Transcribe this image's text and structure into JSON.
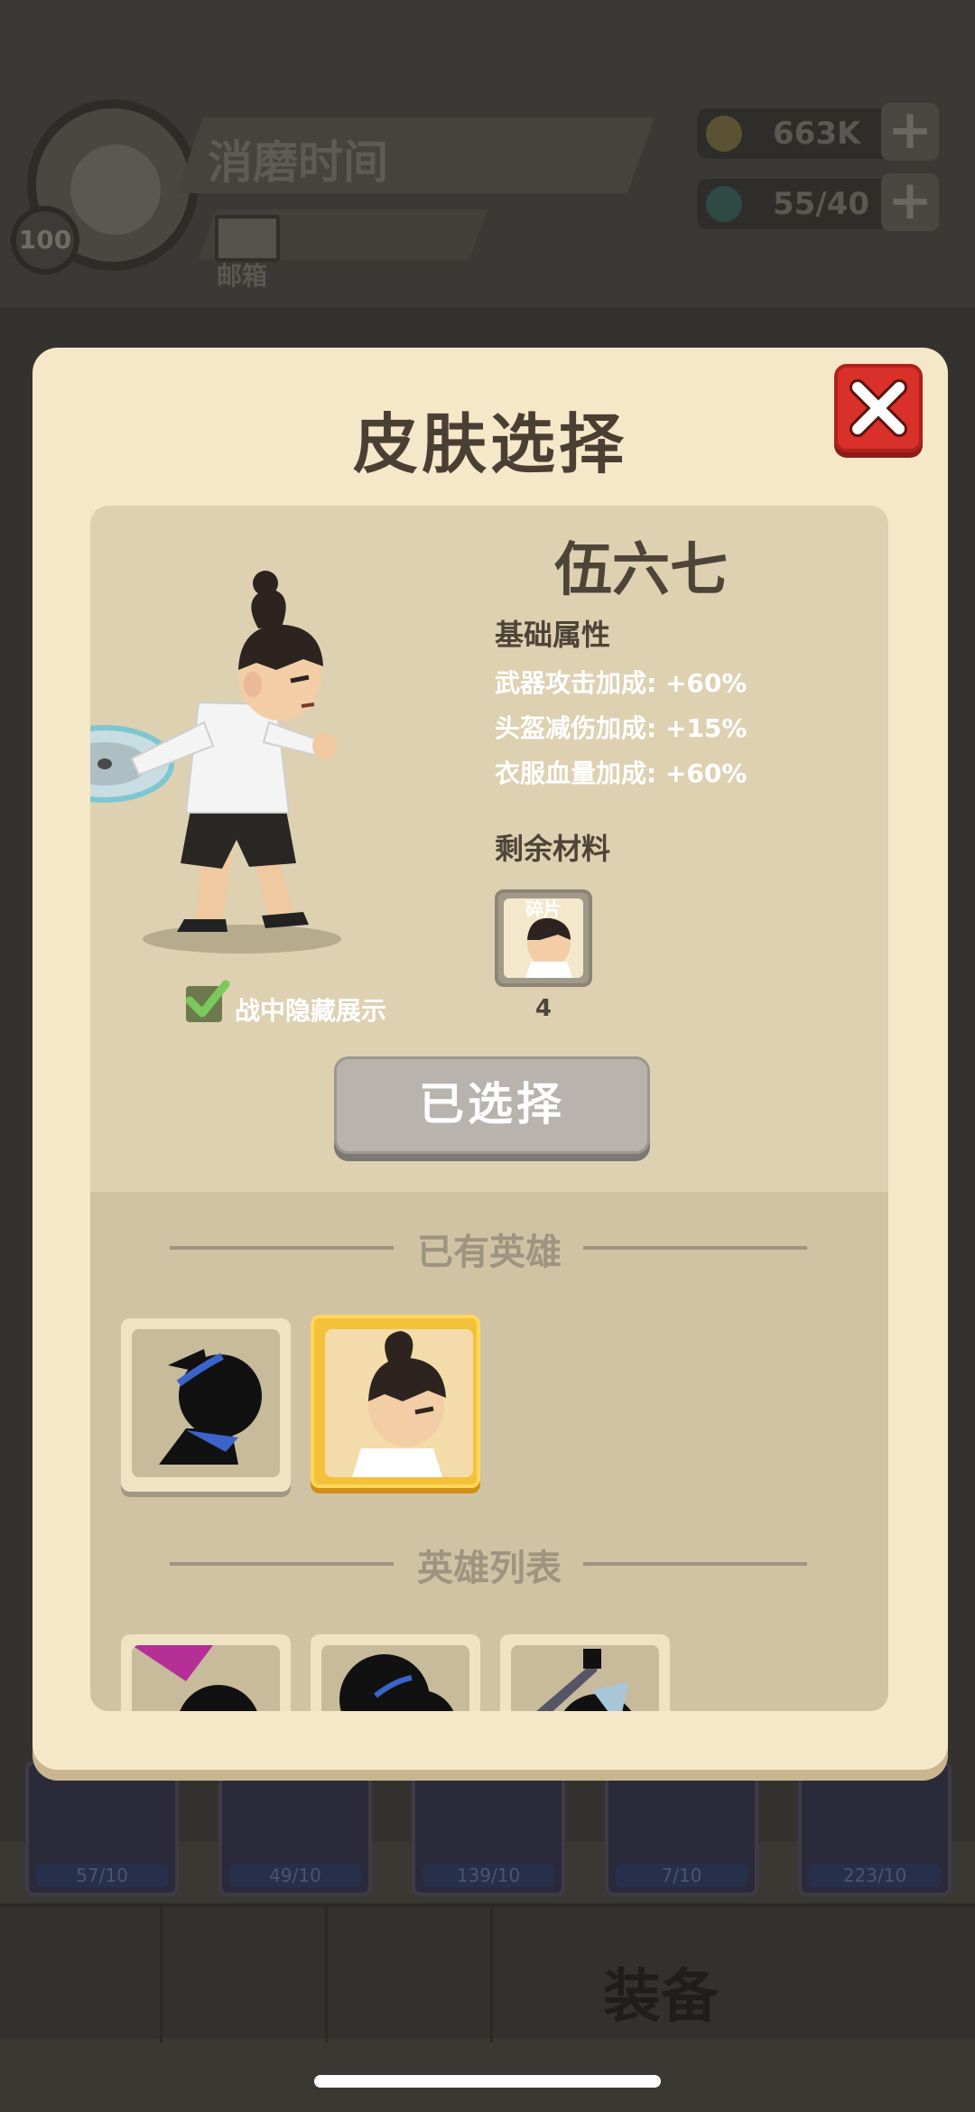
{
  "background": {
    "player_name": "消磨时间",
    "player_level": "100",
    "mail_label": "邮箱",
    "gold": "663K",
    "gems": "55/40",
    "card_counts": [
      "57/10",
      "49/10",
      "139/10",
      "7/10",
      "223/10"
    ],
    "nav_equip_label": "装备"
  },
  "modal": {
    "title": "皮肤选择",
    "hero_name": "伍六七",
    "attributes_title": "基础属性",
    "attributes": [
      "武器攻击加成: +60%",
      "头盔减伤加成: +15%",
      "衣服血量加成: +60%"
    ],
    "materials_title": "剩余材料",
    "fragment_label": "碎片",
    "fragment_count": "4",
    "hide_in_battle_label": "战中隐藏展示",
    "selected_button_label": "已选择",
    "owned_section_title": "已有英雄",
    "list_section_title": "英雄列表"
  },
  "colors": {
    "modal_bg": "#f5e8c8",
    "close_red": "#d9302a",
    "selected_gold": "#f4c13a",
    "check_green": "#7bc95a"
  }
}
